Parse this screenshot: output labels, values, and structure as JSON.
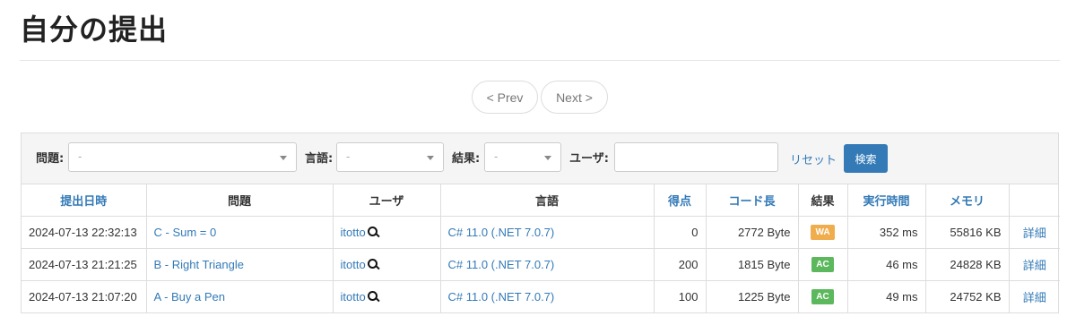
{
  "page": {
    "title": "自分の提出"
  },
  "pagination": {
    "prev": "< Prev",
    "next": "Next >"
  },
  "filters": {
    "task_label": "問題:",
    "task_value": "-",
    "language_label": "言語:",
    "language_value": "-",
    "status_label": "結果:",
    "status_value": "-",
    "user_label": "ユーザ:",
    "user_value": "",
    "reset": "リセット",
    "search": "検索"
  },
  "table": {
    "headers": [
      "提出日時",
      "問題",
      "ユーザ",
      "言語",
      "得点",
      "コード長",
      "結果",
      "実行時間",
      "メモリ",
      ""
    ],
    "rows": [
      {
        "date": "2024-07-13 22:32:13",
        "task": "C - Sum = 0",
        "user": "itotto",
        "lang": "C# 11.0 (.NET 7.0.7)",
        "score": "0",
        "code_len": "2772 Byte",
        "status": "WA",
        "time": "352 ms",
        "memory": "55816 KB",
        "detail": "詳細"
      },
      {
        "date": "2024-07-13 21:21:25",
        "task": "B - Right Triangle",
        "user": "itotto",
        "lang": "C# 11.0 (.NET 7.0.7)",
        "score": "200",
        "code_len": "1815 Byte",
        "status": "AC",
        "time": "46 ms",
        "memory": "24828 KB",
        "detail": "詳細"
      },
      {
        "date": "2024-07-13 21:07:20",
        "task": "A - Buy a Pen",
        "user": "itotto",
        "lang": "C# 11.0 (.NET 7.0.7)",
        "score": "100",
        "code_len": "1225 Byte",
        "status": "AC",
        "time": "49 ms",
        "memory": "24752 KB",
        "detail": "詳細"
      }
    ]
  },
  "colors": {
    "link": "#337ab7",
    "wa": "#f0ad4e",
    "ac": "#5cb85c"
  },
  "icons": {
    "user_search": "magnifier-icon"
  }
}
